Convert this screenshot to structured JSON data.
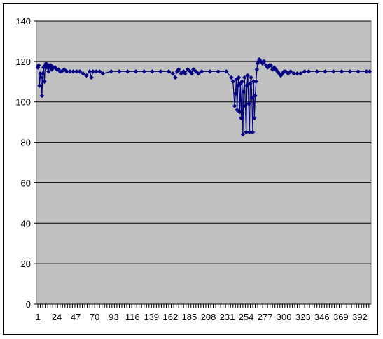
{
  "chart_data": {
    "type": "line",
    "title": "",
    "xlabel": "",
    "ylabel": "",
    "ylim": [
      0,
      140
    ],
    "y_ticks": [
      0,
      20,
      40,
      60,
      80,
      100,
      120,
      140
    ],
    "x_range": [
      1,
      404
    ],
    "x_tick_labels": [
      "1",
      "24",
      "47",
      "70",
      "93",
      "116",
      "139",
      "162",
      "185",
      "208",
      "231",
      "254",
      "277",
      "300",
      "323",
      "346",
      "369",
      "392"
    ],
    "grid": "horizontal",
    "legend": "none",
    "colors": {
      "plot_background": "#c0c0c0",
      "series": "#000080",
      "gridline": "#000000"
    },
    "series": [
      {
        "marker": "diamond",
        "x": [
          1,
          2,
          3,
          4,
          5,
          6,
          7,
          8,
          9,
          10,
          11,
          12,
          13,
          14,
          15,
          16,
          17,
          18,
          20,
          22,
          24,
          26,
          28,
          30,
          33,
          36,
          40,
          44,
          48,
          52,
          56,
          60,
          64,
          66,
          68,
          72,
          76,
          80,
          90,
          100,
          110,
          120,
          130,
          140,
          150,
          160,
          165,
          168,
          170,
          172,
          175,
          178,
          180,
          183,
          186,
          188,
          190,
          193,
          196,
          200,
          210,
          220,
          230,
          236,
          238,
          240,
          241,
          242,
          243,
          244,
          245,
          246,
          247,
          248,
          249,
          250,
          251,
          252,
          253,
          254,
          255,
          256,
          257,
          258,
          259,
          260,
          261,
          262,
          263,
          264,
          265,
          266,
          267,
          268,
          269,
          270,
          272,
          274,
          276,
          278,
          280,
          282,
          284,
          286,
          288,
          290,
          292,
          294,
          296,
          298,
          300,
          302,
          305,
          308,
          312,
          316,
          320,
          325,
          330,
          340,
          350,
          360,
          370,
          380,
          390,
          400,
          404
        ],
        "y": [
          117,
          118,
          108,
          114,
          112,
          103,
          114,
          117,
          110,
          118,
          119,
          117,
          118,
          115,
          118,
          117,
          118,
          116,
          117,
          117,
          116,
          116,
          115,
          115,
          116,
          115,
          115,
          115,
          115,
          115,
          114,
          113,
          115,
          112,
          115,
          115,
          115,
          114,
          115,
          115,
          115,
          115,
          115,
          115,
          115,
          115,
          114,
          112,
          115,
          116,
          114,
          115,
          114,
          116,
          115,
          114,
          116,
          115,
          114,
          115,
          115,
          115,
          115,
          112,
          110,
          98,
          104,
          111,
          96,
          108,
          112,
          95,
          109,
          92,
          110,
          84,
          105,
          112,
          98,
          85,
          108,
          113,
          99,
          85,
          109,
          112,
          102,
          85,
          110,
          92,
          103,
          110,
          116,
          119,
          120,
          121,
          120,
          119,
          120,
          118,
          117,
          118,
          118,
          116,
          117,
          116,
          115,
          114,
          113,
          114,
          115,
          115,
          114,
          115,
          114,
          114,
          114,
          115,
          115,
          115,
          115,
          115,
          115,
          115,
          115,
          115,
          115
        ]
      }
    ]
  }
}
